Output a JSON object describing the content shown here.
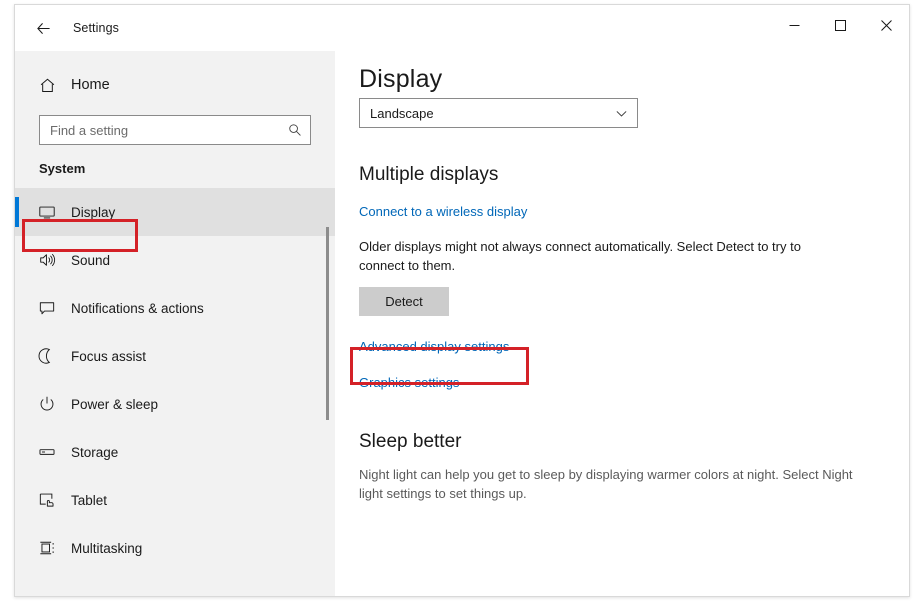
{
  "window": {
    "title": "Settings",
    "back_icon": "back-arrow-icon",
    "controls": {
      "minimize": "—",
      "maximize": "□",
      "close": "✕"
    }
  },
  "sidebar": {
    "home": {
      "label": "Home",
      "icon": "home-icon"
    },
    "search": {
      "value": "",
      "placeholder": "Find a setting",
      "icon": "search-icon"
    },
    "group_title": "System",
    "items": [
      {
        "label": "Display",
        "icon": "monitor-icon",
        "selected": true
      },
      {
        "label": "Sound",
        "icon": "speaker-icon",
        "selected": false
      },
      {
        "label": "Notifications & actions",
        "icon": "speech-bubble-icon",
        "selected": false
      },
      {
        "label": "Focus assist",
        "icon": "moon-icon",
        "selected": false
      },
      {
        "label": "Power & sleep",
        "icon": "power-icon",
        "selected": false
      },
      {
        "label": "Storage",
        "icon": "drive-icon",
        "selected": false
      },
      {
        "label": "Tablet",
        "icon": "tablet-hand-icon",
        "selected": false
      },
      {
        "label": "Multitasking",
        "icon": "multitasking-icon",
        "selected": false
      }
    ]
  },
  "main": {
    "page_title": "Display",
    "orientation_dropdown": {
      "value": "Landscape",
      "icon": "chevron-down-icon"
    },
    "multiple_displays": {
      "heading": "Multiple displays",
      "wireless_link": "Connect to a wireless display",
      "description": "Older displays might not always connect automatically. Select Detect to try to connect to them.",
      "detect_button": "Detect",
      "advanced_link": "Advanced display settings",
      "graphics_link": "Graphics settings"
    },
    "sleep_better": {
      "heading": "Sleep better",
      "description": "Night light can help you get to sleep by displaying warmer colors at night. Select Night light settings to set things up."
    }
  },
  "annotations": {
    "color": "#d42127",
    "targets": [
      "Display",
      "Advanced display settings"
    ]
  },
  "colors": {
    "accent": "#0078d7",
    "link": "#0067b8",
    "sidebar_bg": "#f2f2f2",
    "content_bg": "#ffffff",
    "button_bg": "#cccccc",
    "annotation_red": "#d42127"
  }
}
